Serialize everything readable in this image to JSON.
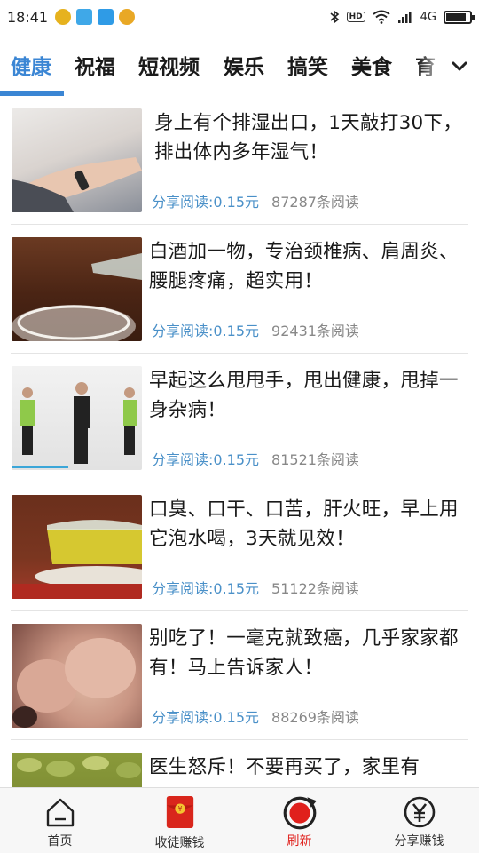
{
  "status_bar": {
    "time": "18:41",
    "network": "4G"
  },
  "tabs": [
    {
      "label": "健康"
    },
    {
      "label": "祝福"
    },
    {
      "label": "短视频"
    },
    {
      "label": "娱乐"
    },
    {
      "label": "搞笑"
    },
    {
      "label": "美食"
    },
    {
      "label": "育"
    }
  ],
  "feed": [
    {
      "title": "身上有个排湿出口，1天敲打30下，排出体内多年湿气！",
      "reward": "分享阅读:0.15元",
      "reads": "87287条阅读",
      "thumb": "arm-wrist-photo"
    },
    {
      "title": "白酒加一物，专治颈椎病、肩周炎、腰腿疼痛，超实用！",
      "reward": "分享阅读:0.15元",
      "reads": "92431条阅读",
      "thumb": "liquor-bottle-glass-photo"
    },
    {
      "title": "早起这么甩甩手，甩出健康，甩掉一身杂病！",
      "reward": "分享阅读:0.15元",
      "reads": "81521条阅读",
      "thumb": "people-exercising-photo"
    },
    {
      "title": "口臭、口干、口苦，肝火旺，早上用它泡水喝，3天就见效！",
      "reward": "分享阅读:0.15元",
      "reads": "51122条阅读",
      "thumb": "tea-glass-photo"
    },
    {
      "title": "别吃了！一毫克就致癌，几乎家家都有！马上告诉家人！",
      "reward": "分享阅读:0.15元",
      "reads": "88269条阅读",
      "thumb": "peanut-closeup-photo"
    },
    {
      "title": "医生怒斥！不要再买了，家里有",
      "reward": "",
      "reads": "",
      "thumb": "green-food-photo"
    }
  ],
  "bottom_nav": [
    {
      "label": "首页",
      "icon": "home-icon"
    },
    {
      "label": "收徒赚钱",
      "icon": "red-envelope-icon"
    },
    {
      "label": "刷新",
      "icon": "refresh-icon"
    },
    {
      "label": "分享赚钱",
      "icon": "yuan-coin-icon"
    }
  ],
  "colors": {
    "accent": "#3b86d4",
    "reward": "#4a90c8",
    "refresh": "#e0201c"
  }
}
